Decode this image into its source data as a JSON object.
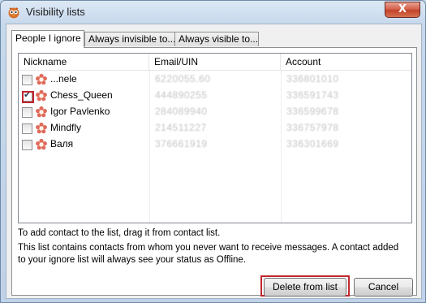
{
  "window": {
    "title": "Visibility lists",
    "close_glyph": "X"
  },
  "tabs": [
    {
      "label": "People I ignore",
      "active": true
    },
    {
      "label": "Always invisible to...",
      "active": false
    },
    {
      "label": "Always visible to...",
      "active": false
    }
  ],
  "table": {
    "columns": [
      "Nickname",
      "Email/UIN",
      "Account"
    ],
    "rows": [
      {
        "nickname": "...nele",
        "email_uin": "6220055.60",
        "account": "336801010",
        "checked": false
      },
      {
        "nickname": "Chess_Queen",
        "email_uin": "444890255",
        "account": "336591743",
        "checked": true
      },
      {
        "nickname": "Igor Pavlenko",
        "email_uin": "284089940",
        "account": "336599678",
        "checked": false
      },
      {
        "nickname": "Mindfly",
        "email_uin": "214511227",
        "account": "336757978",
        "checked": false
      },
      {
        "nickname": "Валя",
        "email_uin": "376661919",
        "account": "336301669",
        "checked": false
      }
    ]
  },
  "info": {
    "drag_hint": "To add contact to the list, drag it from contact list.",
    "description": "This list contains contacts from whom you never want to receive messages. A contact added to your ignore list will always see your status as Offline."
  },
  "buttons": {
    "delete": "Delete from list",
    "cancel": "Cancel"
  },
  "colors": {
    "highlight": "#c0262d",
    "window_frame": "#c6d8ec",
    "close_button": "#c2422b"
  },
  "icons": {
    "app": "owl-icon",
    "contact_status": "flower-icon"
  }
}
